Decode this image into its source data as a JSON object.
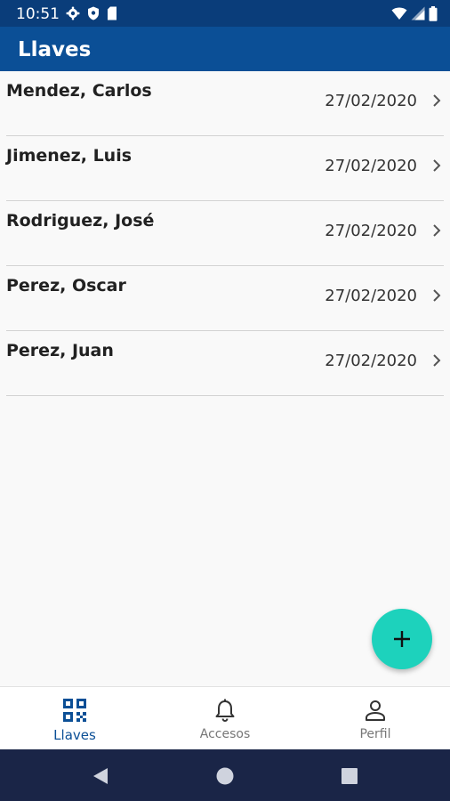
{
  "status_bar": {
    "time": "10:51",
    "left_icons": [
      "gear-icon",
      "shield-icon",
      "sd-card-icon"
    ],
    "right_icons": [
      "wifi-icon",
      "signal-icon",
      "battery-icon"
    ]
  },
  "app_bar": {
    "title": "Llaves"
  },
  "list": {
    "items": [
      {
        "name": "Mendez, Carlos",
        "date": "27/02/2020"
      },
      {
        "name": "Jimenez, Luis",
        "date": "27/02/2020"
      },
      {
        "name": "Rodriguez, José",
        "date": "27/02/2020"
      },
      {
        "name": "Perez, Oscar",
        "date": "27/02/2020"
      },
      {
        "name": "Perez, Juan",
        "date": "27/02/2020"
      }
    ]
  },
  "fab": {
    "icon": "plus-icon",
    "color": "#1dd2bc"
  },
  "bottom_nav": {
    "items": [
      {
        "label": "Llaves",
        "icon": "qr-code-icon",
        "active": true
      },
      {
        "label": "Accesos",
        "icon": "bell-icon",
        "active": false
      },
      {
        "label": "Perfil",
        "icon": "person-icon",
        "active": false
      }
    ]
  },
  "colors": {
    "status_bar": "#0a3d7a",
    "app_bar": "#0b4f96",
    "accent": "#1dd2bc",
    "system_nav": "#1a2547"
  }
}
